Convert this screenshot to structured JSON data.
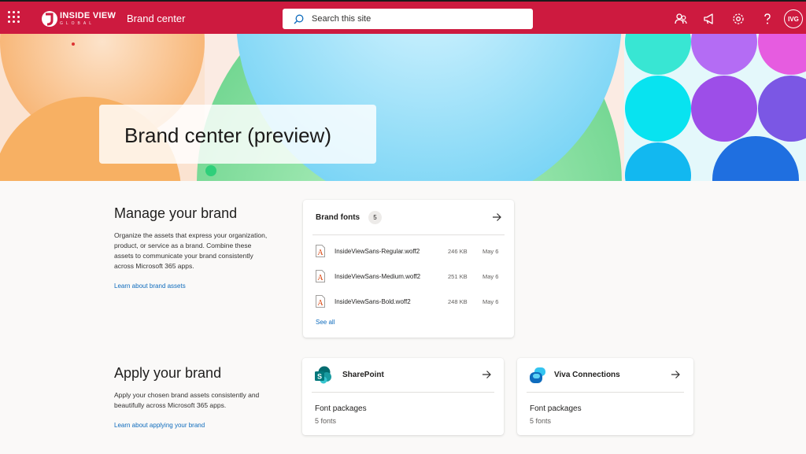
{
  "topbar": {
    "logo_main": "INSIDE VIEW",
    "logo_sub": "GLOBAL",
    "site_title": "Brand center",
    "search_placeholder": "Search this site",
    "avatar_initials": "IVG",
    "accent_color": "#cd1a3f",
    "icons": [
      "app-launcher-icon",
      "people-icon",
      "megaphone-icon",
      "settings-gear-icon",
      "help-icon"
    ]
  },
  "hero": {
    "title": "Brand center (preview)"
  },
  "manage": {
    "title": "Manage your brand",
    "description": "Organize the assets that express your organization, product, or service as a brand. Combine these assets to communicate your brand consistently across Microsoft 365 apps.",
    "link": "Learn about brand assets"
  },
  "fonts_card": {
    "title": "Brand fonts",
    "count": "5",
    "files": [
      {
        "name": "InsideViewSans-Regular.woff2",
        "size": "246 KB",
        "date": "May 6"
      },
      {
        "name": "InsideViewSans-Medium.woff2",
        "size": "251 KB",
        "date": "May 6"
      },
      {
        "name": "InsideViewSans-Bold.woff2",
        "size": "248 KB",
        "date": "May 6"
      }
    ],
    "see_all": "See all"
  },
  "apply": {
    "title": "Apply your brand",
    "description": "Apply your chosen brand assets consistently and beautifully across Microsoft 365 apps.",
    "link": "Learn about applying your brand"
  },
  "apps": [
    {
      "name": "SharePoint",
      "package_title": "Font packages",
      "package_count": "5 fonts",
      "icon_color": "#03787c"
    },
    {
      "name": "Viva Connections",
      "package_title": "Font packages",
      "package_count": "5 fonts",
      "icon_color": "#0f6cbd"
    }
  ]
}
